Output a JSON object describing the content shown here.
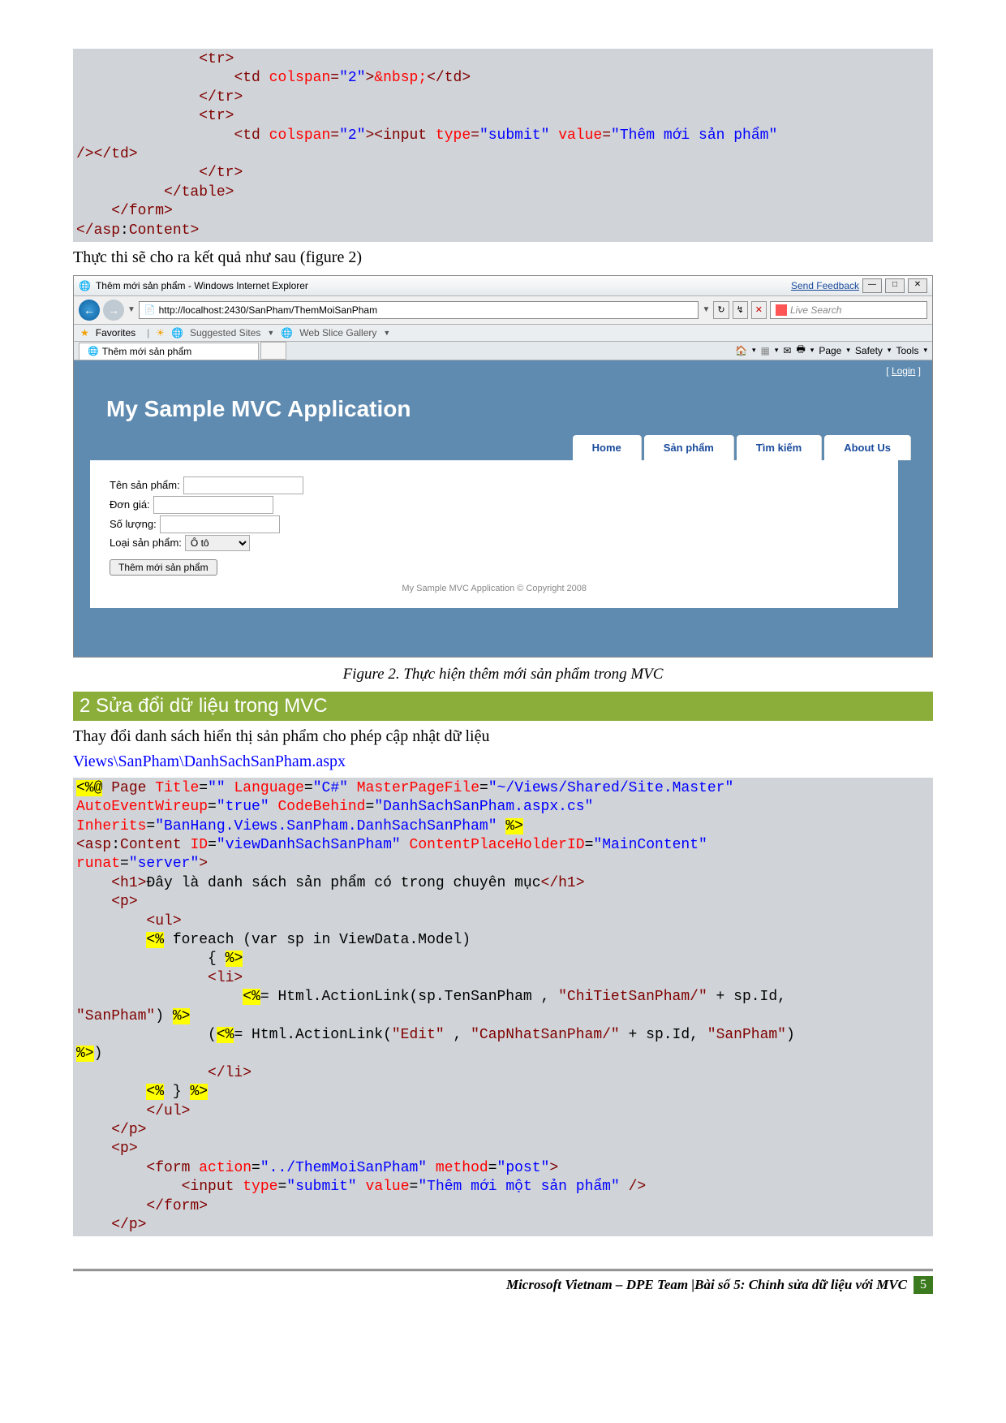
{
  "code1": {
    "lines": [
      {
        "indent": 14,
        "html": "<span class='tag'>&lt;tr&gt;</span>"
      },
      {
        "indent": 18,
        "html": "<span class='tag'>&lt;td </span><span class='attr'>colspan</span><span class='tag'>=</span><span class='val'>\"2\"</span><span class='tag'>&gt;</span><span class='attr'>&amp;nbsp;</span><span class='tag'>&lt;/td&gt;</span>"
      },
      {
        "indent": 14,
        "html": "<span class='tag'>&lt;/tr&gt;</span>"
      },
      {
        "indent": 14,
        "html": "<span class='tag'>&lt;tr&gt;</span>"
      },
      {
        "indent": 18,
        "html": "<span class='tag'>&lt;td </span><span class='attr'>colspan</span><span class='tag'>=</span><span class='val'>\"2\"</span><span class='tag'>&gt;&lt;input </span><span class='attr'>type</span><span class='tag'>=</span><span class='val'>\"submit\"</span> <span class='attr'>value</span><span class='tag'>=</span><span class='val'>\"Thêm mới sản phẩm\"</span>"
      },
      {
        "indent": 0,
        "html": "<span class='tag'>/&gt;&lt;/td&gt;</span>"
      },
      {
        "indent": 14,
        "html": "<span class='tag'>&lt;/tr&gt;</span>"
      },
      {
        "indent": 10,
        "html": "<span class='tag'>&lt;/table&gt;</span>"
      },
      {
        "indent": 4,
        "html": "<span class='tag'>&lt;/form&gt;</span>"
      },
      {
        "indent": 0,
        "html": "<span class='tag'>&lt;/asp</span>:<span class='tag'>Content&gt;</span>"
      }
    ]
  },
  "body_text_1": "Thực thi sẽ cho ra kết quả như sau (figure 2)",
  "browser": {
    "title": "Thêm mới sản phẩm - Windows Internet Explorer",
    "send_feedback": "Send Feedback",
    "url": "http://localhost:2430/SanPham/ThemMoiSanPham",
    "search_placeholder": "Live Search",
    "favorites": "Favorites",
    "suggested": "Suggested Sites",
    "webslice": "Web Slice Gallery",
    "tab": "Thêm mới sản phẩm",
    "tool_page": "Page",
    "tool_safety": "Safety",
    "tool_tools": "Tools",
    "login": "Login",
    "site_title": "My Sample MVC Application",
    "nav": [
      "Home",
      "Sản phẩm",
      "Tìm kiếm",
      "About Us"
    ],
    "form": {
      "label1": "Tên sản phẩm:",
      "label2": "Đơn giá:",
      "label3": "Số lượng:",
      "label4": "Loại sản phẩm:",
      "select_val": "Ô tô",
      "submit": "Thêm mới sản phẩm"
    },
    "copyright": "My Sample MVC Application © Copyright 2008"
  },
  "caption": "Figure 2. Thực hiện thêm mới sản phẩm trong MVC",
  "section_header": "2   Sửa đổi dữ liệu trong MVC",
  "body_text_2": "Thay đổi danh sách hiển thị sản phẩm cho phép cập nhật dữ liệu",
  "file_path": "Views\\SanPham\\DanhSachSanPham.aspx",
  "code2": {
    "lines": [
      {
        "html": "<span class='bg-yellow'>&lt;%@</span> <span class='tag'>Page</span> <span class='attr'>Title</span>=<span class='val'>\"\"</span> <span class='attr'>Language</span>=<span class='val'>\"C#\"</span> <span class='attr'>MasterPageFile</span>=<span class='val'>\"~/Views/Shared/Site.Master\"</span>"
      },
      {
        "html": "<span class='attr'>AutoEventWireup</span>=<span class='val'>\"true\"</span> <span class='attr'>CodeBehind</span>=<span class='val'>\"DanhSachSanPham.aspx.cs\"</span>"
      },
      {
        "html": "<span class='attr'>Inherits</span>=<span class='val'>\"BanHang.Views.SanPham.DanhSachSanPham\"</span> <span class='bg-yellow'>%&gt;</span>"
      },
      {
        "html": "<span class='tag'>&lt;asp</span>:<span class='tag'>Content</span> <span class='attr'>ID</span>=<span class='val'>\"viewDanhSachSanPham\"</span> <span class='attr'>ContentPlaceHolderID</span>=<span class='val'>\"MainContent\"</span>"
      },
      {
        "html": "<span class='attr'>runat</span>=<span class='val'>\"server\"</span><span class='tag'>&gt;</span>"
      },
      {
        "html": "    <span class='tag'>&lt;h1&gt;</span>Đây là danh sách sản phẩm có trong chuyên mục<span class='tag'>&lt;/h1&gt;</span>"
      },
      {
        "html": "    <span class='tag'>&lt;p&gt;</span>"
      },
      {
        "html": "        <span class='tag'>&lt;ul&gt;</span>"
      },
      {
        "html": "        <span class='bg-yellow'>&lt;%</span> foreach (var sp in ViewData.Model)"
      },
      {
        "html": "               { <span class='bg-yellow'>%&gt;</span>"
      },
      {
        "html": "               <span class='tag'>&lt;li&gt;</span>"
      },
      {
        "html": "                   <span class='bg-yellow'>&lt;%</span>= Html.ActionLink(sp.TenSanPham , <span class='tag'>\"ChiTietSanPham/\"</span> + sp.Id,"
      },
      {
        "html": "<span class='tag'>\"SanPham\"</span>) <span class='bg-yellow'>%&gt;</span>"
      },
      {
        "html": "               (<span class='bg-yellow'>&lt;%</span>= Html.ActionLink(<span class='tag'>\"Edit\"</span> , <span class='tag'>\"CapNhatSanPham/\"</span> + sp.Id, <span class='tag'>\"SanPham\"</span>)"
      },
      {
        "html": "<span class='bg-yellow'>%&gt;</span>)"
      },
      {
        "html": "               <span class='tag'>&lt;/li&gt;</span>"
      },
      {
        "html": "        <span class='bg-yellow'>&lt;%</span> } <span class='bg-yellow'>%&gt;</span>"
      },
      {
        "html": "        <span class='tag'>&lt;/ul&gt;</span>"
      },
      {
        "html": "    <span class='tag'>&lt;/p&gt;</span>"
      },
      {
        "html": "    <span class='tag'>&lt;p&gt;</span>"
      },
      {
        "html": "        <span class='tag'>&lt;form </span><span class='attr'>action</span>=<span class='val'>\"../ThemMoiSanPham\"</span> <span class='attr'>method</span>=<span class='val'>\"post\"</span><span class='tag'>&gt;</span>"
      },
      {
        "html": "            <span class='tag'>&lt;input </span><span class='attr'>type</span>=<span class='val'>\"submit\"</span> <span class='attr'>value</span>=<span class='val'>\"Thêm mới một sản phẩm\"</span> <span class='tag'>/&gt;</span>"
      },
      {
        "html": "        <span class='tag'>&lt;/form&gt;</span>"
      },
      {
        "html": "    <span class='tag'>&lt;/p&gt;</span>"
      }
    ]
  },
  "footer_text": "Microsoft Vietnam – DPE Team |Bài số 5: Chỉnh sửa dữ liệu với MVC",
  "page_number": "5"
}
